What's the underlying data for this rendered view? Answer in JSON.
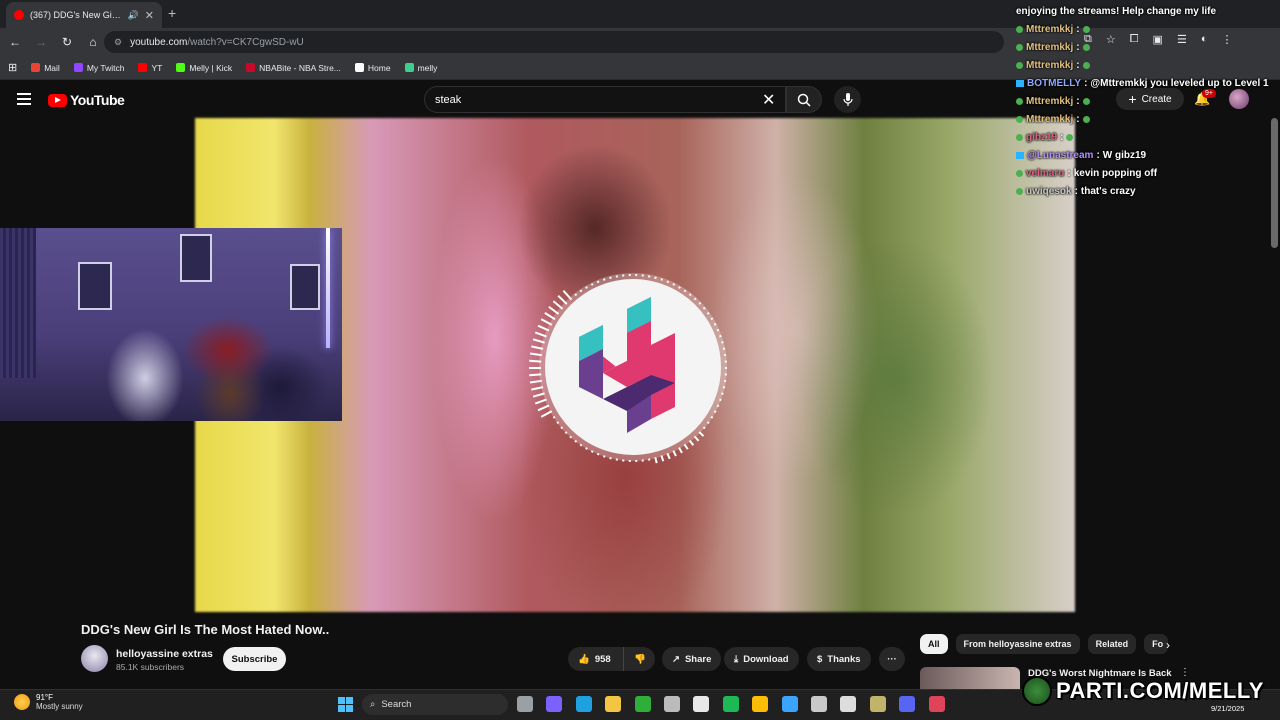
{
  "browser": {
    "tab_title": "(367) DDG's New Girl Is The",
    "new_tab_symbol": "+",
    "url_host": "youtube.com",
    "url_path": "/watch?v=CK7CgwSD-wU",
    "bookmarks": [
      {
        "label": "Mail",
        "icon": "gmail-icon",
        "color": "#ea4335"
      },
      {
        "label": "My Twitch",
        "icon": "twitch-icon",
        "color": "#9146ff"
      },
      {
        "label": "YT",
        "icon": "youtube-icon",
        "color": "#ff0000"
      },
      {
        "label": "Melly | Kick",
        "icon": "kick-icon",
        "color": "#53fc18"
      },
      {
        "label": "NBABite - NBA Stre...",
        "icon": "nba-icon",
        "color": "#c9082a"
      },
      {
        "label": "Home",
        "icon": "x-icon",
        "color": "#ffffff"
      },
      {
        "label": "melly",
        "icon": "leaf-icon",
        "color": "#3ecf8e"
      }
    ]
  },
  "youtube": {
    "logo_text": "YouTube",
    "search_value": "steak",
    "create_label": "Create",
    "notification_count": "9+"
  },
  "chat": [
    {
      "user": "",
      "text": "enjoying the streams! Help change my life",
      "style": "text-only"
    },
    {
      "user": "Mttremkkj",
      "text": "",
      "style": "dot"
    },
    {
      "user": "Mttremkkj",
      "text": "",
      "style": "dot"
    },
    {
      "user": "Mttremkkj",
      "text": "",
      "style": "dot"
    },
    {
      "user": "BOTMELLY",
      "text": "@Mttremkkj you leveled up to Level 1",
      "style": "bot"
    },
    {
      "user": "Mttremkkj",
      "text": "",
      "style": "dot"
    },
    {
      "user": "Mttremkkj",
      "text": "",
      "style": "dot"
    },
    {
      "user": "gibz19",
      "text": "",
      "style": "pink"
    },
    {
      "user": "@Lunastream",
      "text": "W gibz19",
      "style": "purple"
    },
    {
      "user": "velmaru",
      "text": "kevin popping off",
      "style": "pink"
    },
    {
      "user": "uwiqesok",
      "text": "that's crazy",
      "style": "gray"
    }
  ],
  "video": {
    "title": "DDG's New Girl Is The Most Hated Now..",
    "channel_name": "helloyassine extras",
    "subscribers": "85.1K subscribers",
    "subscribe_label": "Subscribe",
    "like_count": "958",
    "share_label": "Share",
    "download_label": "Download",
    "thanks_label": "Thanks",
    "more_label": "···"
  },
  "chips": [
    "All",
    "From helloyassine extras",
    "Related",
    "Fo"
  ],
  "recommendation": {
    "title": "DDG's Worst Nightmare Is Back",
    "more": "⋮"
  },
  "watermark": "PARTI.COM/MELLY",
  "taskbar": {
    "temperature": "91°F",
    "weather": "Mostly sunny",
    "search_label": "Search",
    "date": "9/21/2025",
    "icons": [
      {
        "name": "task-view-icon",
        "color": "#9aa0a6"
      },
      {
        "name": "copilot-icon",
        "color": "#7b61ff"
      },
      {
        "name": "edge-icon",
        "color": "#1fa0e0"
      },
      {
        "name": "file-explorer-icon",
        "color": "#f4c542"
      },
      {
        "name": "xbox-icon",
        "color": "#2fae3a"
      },
      {
        "name": "obs-icon",
        "color": "#bbbbbb"
      },
      {
        "name": "store-icon",
        "color": "#e8e8e8"
      },
      {
        "name": "spotify-icon",
        "color": "#1db954"
      },
      {
        "name": "chrome-icon",
        "color": "#fbbc05"
      },
      {
        "name": "photos-icon",
        "color": "#3ba4ff"
      },
      {
        "name": "media-player-icon",
        "color": "#c9c9c9"
      },
      {
        "name": "capcut-icon",
        "color": "#dddddd"
      },
      {
        "name": "app-icon",
        "color": "#c2b36b"
      },
      {
        "name": "discord-icon",
        "color": "#5865f2"
      },
      {
        "name": "maps-pin-icon",
        "color": "#e0445a"
      }
    ]
  }
}
